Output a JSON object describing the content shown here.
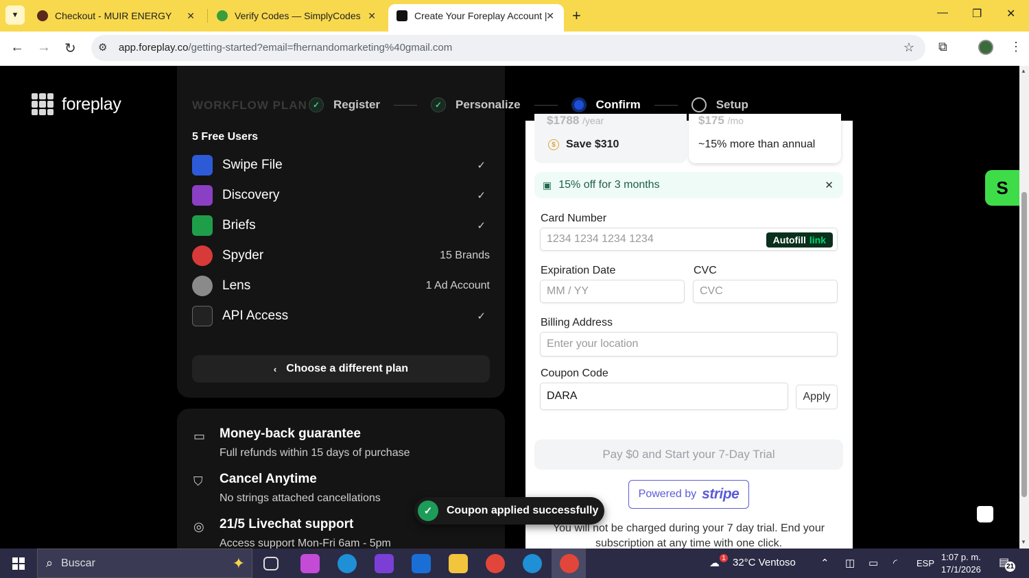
{
  "browser": {
    "tabs": [
      {
        "title": "Checkout - MUIR ENERGY",
        "favicon_color": "#5a2a1a"
      },
      {
        "title": "Verify Codes — SimplyCodes",
        "favicon_color": "#3a9d3a"
      },
      {
        "title": "Create Your Foreplay Account |",
        "favicon_color": "#111111"
      }
    ],
    "url_host": "app.foreplay.co",
    "url_path": "/getting-started?email=fhernandomarketing%40gmail.com"
  },
  "page": {
    "logo_text": "foreplay",
    "steps": [
      {
        "label": "Register",
        "state": "done"
      },
      {
        "label": "Personalize",
        "state": "done"
      },
      {
        "label": "Confirm",
        "state": "current"
      },
      {
        "label": "Setup",
        "state": "todo"
      }
    ],
    "plan": {
      "faded_title": "WORKFLOW PLAN",
      "users": "5 Free Users",
      "features": [
        {
          "name": "Swipe File",
          "value": "✓",
          "icon": "swipe-file-icon",
          "color": "#2d5bd8"
        },
        {
          "name": "Discovery",
          "value": "✓",
          "icon": "discovery-icon",
          "color": "#8b3fc4"
        },
        {
          "name": "Briefs",
          "value": "✓",
          "icon": "briefs-icon",
          "color": "#1f9e4a"
        },
        {
          "name": "Spyder",
          "value": "15 Brands",
          "icon": "spyder-icon",
          "color": "#d83a3a"
        },
        {
          "name": "Lens",
          "value": "1 Ad Account",
          "icon": "lens-icon",
          "color": "#8a8a8a"
        },
        {
          "name": "API Access",
          "value": "✓",
          "icon": "api-icon",
          "color": "#444444"
        }
      ],
      "choose_label": "Choose a different plan"
    },
    "guarantees": [
      {
        "title": "Money-back guarantee",
        "desc": "Full refunds within 15 days of purchase",
        "icon": "refund-icon"
      },
      {
        "title": "Cancel Anytime",
        "desc": "No strings attached cancellations",
        "icon": "shield-icon"
      },
      {
        "title": "21/5 Livechat support",
        "desc": "Access support Mon-Fri 6am - 5pm",
        "icon": "lifebuoy-icon"
      }
    ],
    "payment": {
      "annual_price": "$1788",
      "annual_unit": "/year",
      "annual_save": "Save $310",
      "monthly_price": "$175",
      "monthly_unit": "/mo",
      "monthly_note": "~15% more than annual",
      "promo": "15% off for 3 months",
      "card_label": "Card Number",
      "card_placeholder": "1234 1234 1234 1234",
      "autofill": "Autofill",
      "autofill_link": "link",
      "exp_label": "Expiration Date",
      "exp_placeholder": "MM / YY",
      "cvc_label": "CVC",
      "cvc_placeholder": "CVC",
      "billing_label": "Billing Address",
      "billing_placeholder": "Enter your location",
      "coupon_label": "Coupon Code",
      "coupon_value": "DARA",
      "apply_label": "Apply",
      "pay_label": "Pay $0 and Start your 7-Day Trial",
      "powered_by": "Powered by",
      "stripe": "stripe",
      "trial_note": "You will not be charged during your 7 day trial. End your subscription at any time with one click."
    },
    "toast": "Coupon applied successfully",
    "simply_label": "S"
  },
  "taskbar": {
    "search_placeholder": "Buscar",
    "weather": "32°C  Ventoso",
    "lang": "ESP",
    "time": "1:07 p. m.",
    "date": "17/1/2026",
    "notif_count": "21",
    "weather_badge": "1"
  }
}
